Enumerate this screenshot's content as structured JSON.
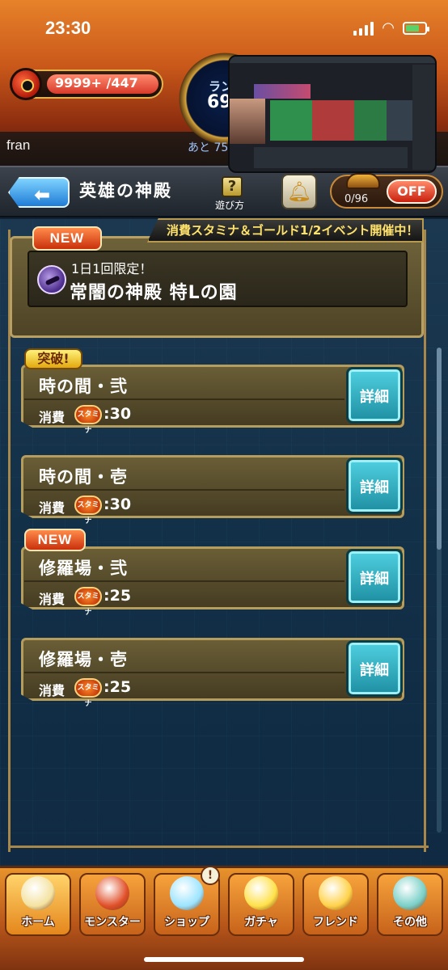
{
  "status": {
    "time": "23:30"
  },
  "hud": {
    "stamina": "9999+ /447",
    "stamina_fill": 1.0,
    "rank_label": "ラン",
    "rank_value": "69",
    "player_name": "fran",
    "exp_text": "あと 75"
  },
  "header": {
    "back_icon": "back-arrow-icon",
    "title": "英雄の神殿",
    "help_symbol": "?",
    "help_label": "遊び方",
    "bell_icon": "bell-icon",
    "box_counter": "0/96",
    "toggle_label": "OFF"
  },
  "event_banner": "消費スタミナ＆ゴールド1/2イベント開催中！",
  "featured": {
    "tag": "NEW",
    "subtitle": "1日1回限定！",
    "title": "常闇の神殿 特Lの園"
  },
  "quests": [
    {
      "badge": "突破!",
      "title": "時の間・弐",
      "cost_label": "消費",
      "stamina_icon": "スタミナ",
      "cost": ":30",
      "detail": "詳細"
    },
    {
      "badge": "",
      "title": "時の間・壱",
      "cost_label": "消費",
      "stamina_icon": "スタミナ",
      "cost": ":30",
      "detail": "詳細"
    },
    {
      "badge": "NEW",
      "title": "修羅場・弐",
      "cost_label": "消費",
      "stamina_icon": "スタミナ",
      "cost": ":25",
      "detail": "詳細"
    },
    {
      "badge": "",
      "title": "修羅場・壱",
      "cost_label": "消費",
      "stamina_icon": "スタミナ",
      "cost": ":25",
      "detail": "詳細"
    }
  ],
  "nav": {
    "alert": "!",
    "items": [
      {
        "label": "ホーム",
        "icon": "home-icon",
        "color": "#f4e2a0"
      },
      {
        "label": "モンスター",
        "icon": "monster-icon",
        "color": "#e0502a"
      },
      {
        "label": "ショップ",
        "icon": "orb-icon",
        "color": "#9be4ff"
      },
      {
        "label": "ガチャ",
        "icon": "gacha-icon",
        "color": "#ffe14a"
      },
      {
        "label": "フレンド",
        "icon": "friend-icon",
        "color": "#ffd24a"
      },
      {
        "label": "その他",
        "icon": "other-icon",
        "color": "#7ad0c8"
      }
    ]
  }
}
